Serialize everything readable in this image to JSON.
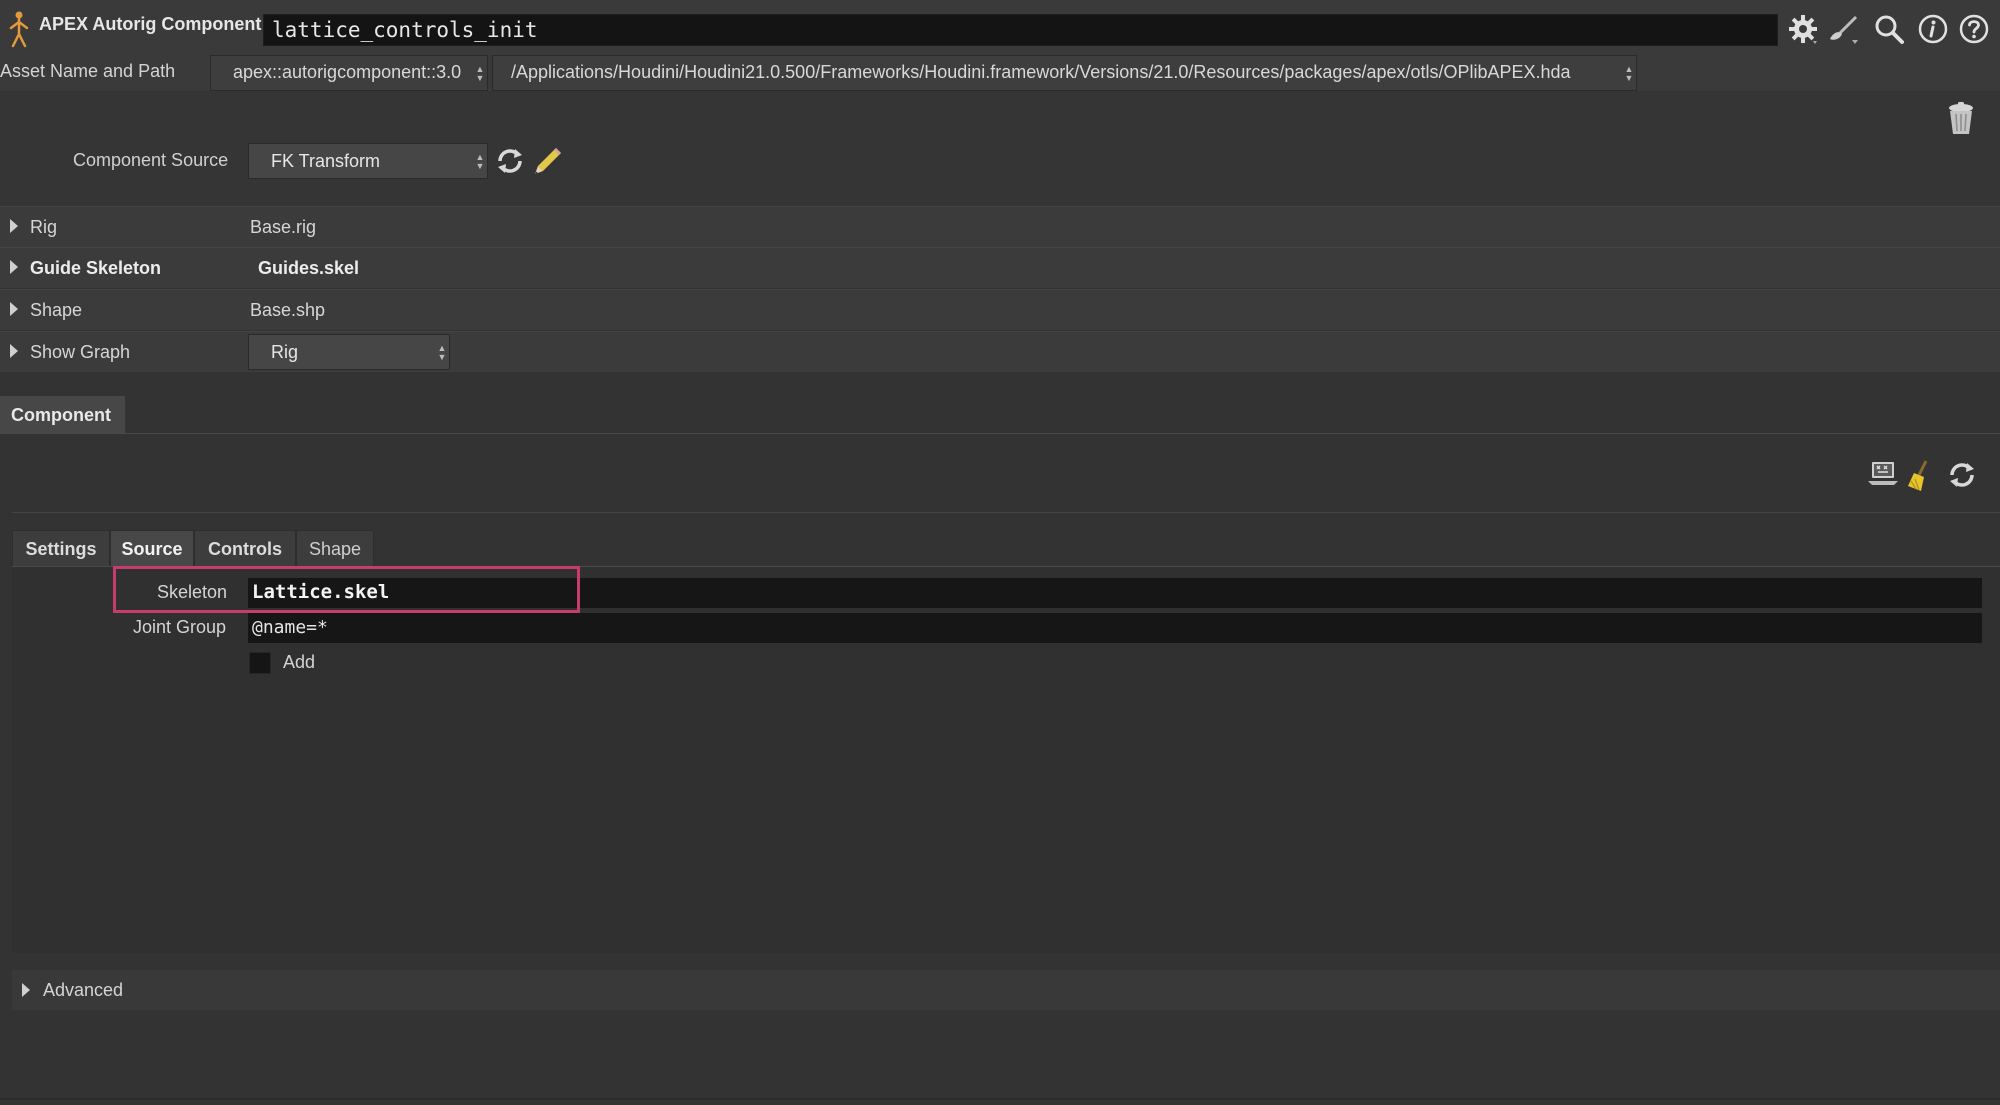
{
  "header": {
    "node_type": "APEX Autorig Component",
    "node_name": "lattice_controls_init",
    "icons": [
      "apex-figure-icon",
      "gear-icon",
      "brush-icon",
      "search-icon",
      "info-icon",
      "help-icon"
    ]
  },
  "asset": {
    "label": "Asset Name and Path",
    "name": "apex::autorigcomponent::3.0",
    "path": "/Applications/Houdini/Houdini21.0.500/Frameworks/Houdini.framework/Versions/21.0/Resources/packages/apex/otls/OPlibAPEX.hda"
  },
  "component_source": {
    "label": "Component Source",
    "value": "FK Transform"
  },
  "params": [
    {
      "label": "Rig",
      "value": "Base.rig"
    },
    {
      "label": "Guide Skeleton",
      "value": "Guides.skel"
    },
    {
      "label": "Shape",
      "value": "Base.shp"
    },
    {
      "label": "Show Graph",
      "value": "Rig"
    }
  ],
  "folder": {
    "tab": "Component"
  },
  "subtabs": [
    "Settings",
    "Source",
    "Controls",
    "Shape"
  ],
  "source": {
    "skeleton_label": "Skeleton",
    "skeleton_value": "Lattice.skel",
    "joint_group_label": "Joint Group",
    "joint_group_value": "@name=*",
    "add_label": "Add",
    "add_checked": false
  },
  "advanced": {
    "label": "Advanced"
  },
  "colors": {
    "highlight": "#c73b6e",
    "background": "#333333"
  }
}
